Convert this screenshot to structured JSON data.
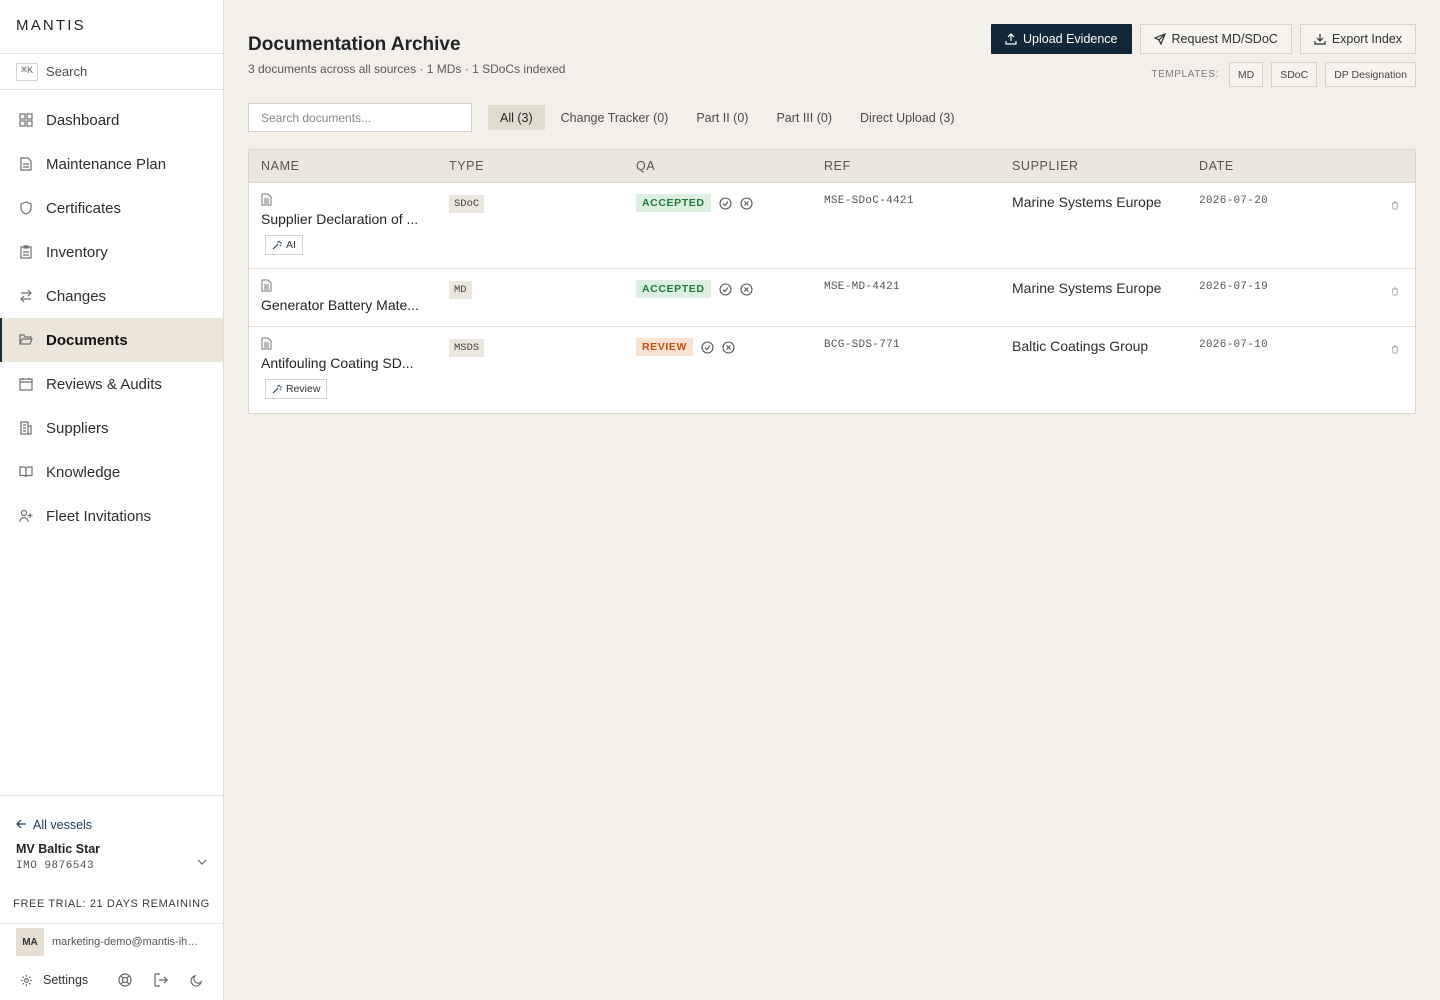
{
  "app": {
    "brand": "MANTIS"
  },
  "sidebar": {
    "search": {
      "shortcut": "⌘K",
      "label": "Search"
    },
    "items": [
      {
        "label": "Dashboard",
        "icon": "dashboard-icon"
      },
      {
        "label": "Maintenance Plan",
        "icon": "file-icon"
      },
      {
        "label": "Certificates",
        "icon": "shield-icon"
      },
      {
        "label": "Inventory",
        "icon": "clipboard-icon"
      },
      {
        "label": "Changes",
        "icon": "arrows-icon"
      },
      {
        "label": "Documents",
        "icon": "folder-open-icon",
        "active": true
      },
      {
        "label": "Reviews & Audits",
        "icon": "calendar-icon"
      },
      {
        "label": "Suppliers",
        "icon": "building-icon"
      },
      {
        "label": "Knowledge",
        "icon": "book-icon"
      },
      {
        "label": "Fleet Invitations",
        "icon": "user-plus-icon"
      }
    ],
    "all_vessels": "All vessels",
    "vessel": {
      "name": "MV Baltic Star",
      "imo": "IMO 9876543"
    },
    "trial": "FREE TRIAL: 21 DAYS REMAINING",
    "user": {
      "initials": "MA",
      "email": "marketing-demo@mantis-ihm.l..."
    },
    "settings_label": "Settings"
  },
  "header": {
    "title": "Documentation Archive",
    "subtitle": "3 documents across all sources · 1 MDs · 1 SDoCs indexed",
    "actions": {
      "upload": "Upload Evidence",
      "request": "Request MD/SDoC",
      "export": "Export Index"
    },
    "templates": {
      "label": "TEMPLATES:",
      "items": [
        "MD",
        "SDoC",
        "DP Designation"
      ]
    }
  },
  "filters": {
    "search_placeholder": "Search documents...",
    "tabs": [
      "All (3)",
      "Change Tracker (0)",
      "Part II (0)",
      "Part III (0)",
      "Direct Upload (3)"
    ]
  },
  "table": {
    "columns": [
      "NAME",
      "TYPE",
      "QA",
      "REF",
      "SUPPLIER",
      "DATE"
    ],
    "rows": [
      {
        "name": "Supplier Declaration of ...",
        "tag": "AI",
        "type": "SDoC",
        "qa": "ACCEPTED",
        "ref": "MSE-SDoC-4421",
        "supplier": "Marine Systems Europe",
        "date": "2026-07-20"
      },
      {
        "name": "Generator Battery Mate...",
        "tag": "",
        "type": "MD",
        "qa": "ACCEPTED",
        "ref": "MSE-MD-4421",
        "supplier": "Marine Systems Europe",
        "date": "2026-07-19"
      },
      {
        "name": "Antifouling Coating SD...",
        "tag": "Review",
        "type": "MSDS",
        "qa": "REVIEW",
        "ref": "BCG-SDS-771",
        "supplier": "Baltic Coatings Group",
        "date": "2026-07-10"
      }
    ]
  },
  "colors": {
    "primary": "#12283a",
    "accepted": "#1e7a3c",
    "review": "#c2500f",
    "background": "#f3f0e9"
  }
}
